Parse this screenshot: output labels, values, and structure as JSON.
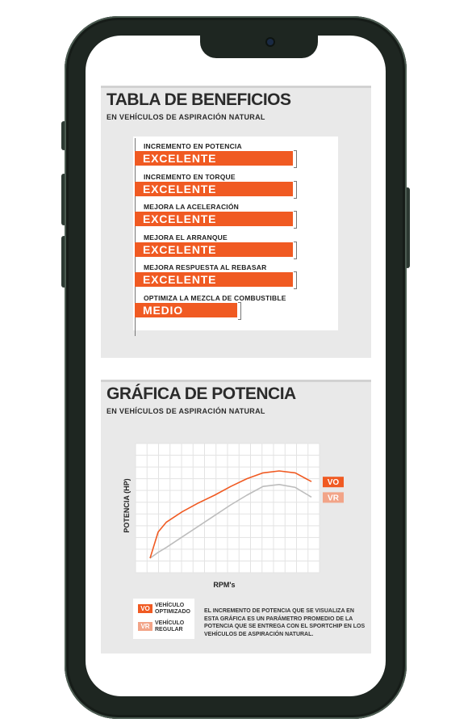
{
  "colors": {
    "accent": "#f05a22",
    "accent_light": "#f2a488",
    "regular_line": "#bdbdbd"
  },
  "benefits": {
    "title": "TABLA DE BENEFICIOS",
    "subtitle": "EN VEHÍCULOS DE ASPIRACIÓN NATURAL",
    "items": [
      {
        "label": "INCREMENTO EN POTENCIA",
        "value": "EXCELENTE",
        "level": 1.0
      },
      {
        "label": "INCREMENTO EN TORQUE",
        "value": "EXCELENTE",
        "level": 1.0
      },
      {
        "label": "MEJORA LA ACELERACIÓN",
        "value": "EXCELENTE",
        "level": 1.0
      },
      {
        "label": "MEJORA EL ARRANQUE",
        "value": "EXCELENTE",
        "level": 1.0
      },
      {
        "label": "MEJORA RESPUESTA AL REBASAR",
        "value": "EXCELENTE",
        "level": 1.0
      },
      {
        "label": "OPTIMIZA LA MEZCLA DE COMBUSTIBLE",
        "value": "MEDIO",
        "level": 0.65
      }
    ]
  },
  "power": {
    "title": "GRÁFICA DE POTENCIA",
    "subtitle": "EN VEHÍCULOS DE ASPIRACIÓN NATURAL",
    "legend": [
      {
        "badge": "VO",
        "label": "VEHÍCULO\nOPTIMIZADO"
      },
      {
        "badge": "VR",
        "label": "VEHÍCULO\nREGULAR"
      }
    ],
    "note": "EL INCREMENTO DE POTENCIA QUE SE VISUALIZA EN ESTA GRÁFICA ES UN PARÁMETRO PROMEDIO DE LA POTENCIA QUE SE ENTREGA CON EL SPORTCHIP EN LOS VEHÍCULOS DE ASPIRACIÓN NATURAL."
  },
  "chart_data": {
    "type": "line",
    "title": "",
    "xlabel": "RPM's",
    "ylabel": "POTENCIA (HP)",
    "x": [
      0,
      0.05,
      0.1,
      0.2,
      0.3,
      0.4,
      0.5,
      0.6,
      0.7,
      0.8,
      0.9,
      1.0
    ],
    "xlim": [
      0,
      1
    ],
    "ylim": [
      0,
      1
    ],
    "grid": true,
    "legend_position": "bottom-left",
    "series": [
      {
        "name": "VO",
        "color": "#f05a22",
        "values": [
          0.05,
          0.32,
          0.42,
          0.53,
          0.62,
          0.7,
          0.79,
          0.87,
          0.93,
          0.95,
          0.93,
          0.84
        ]
      },
      {
        "name": "VR",
        "color": "#bdbdbd",
        "values": [
          0.05,
          0.11,
          0.16,
          0.27,
          0.38,
          0.49,
          0.6,
          0.7,
          0.79,
          0.81,
          0.78,
          0.68
        ]
      }
    ]
  }
}
